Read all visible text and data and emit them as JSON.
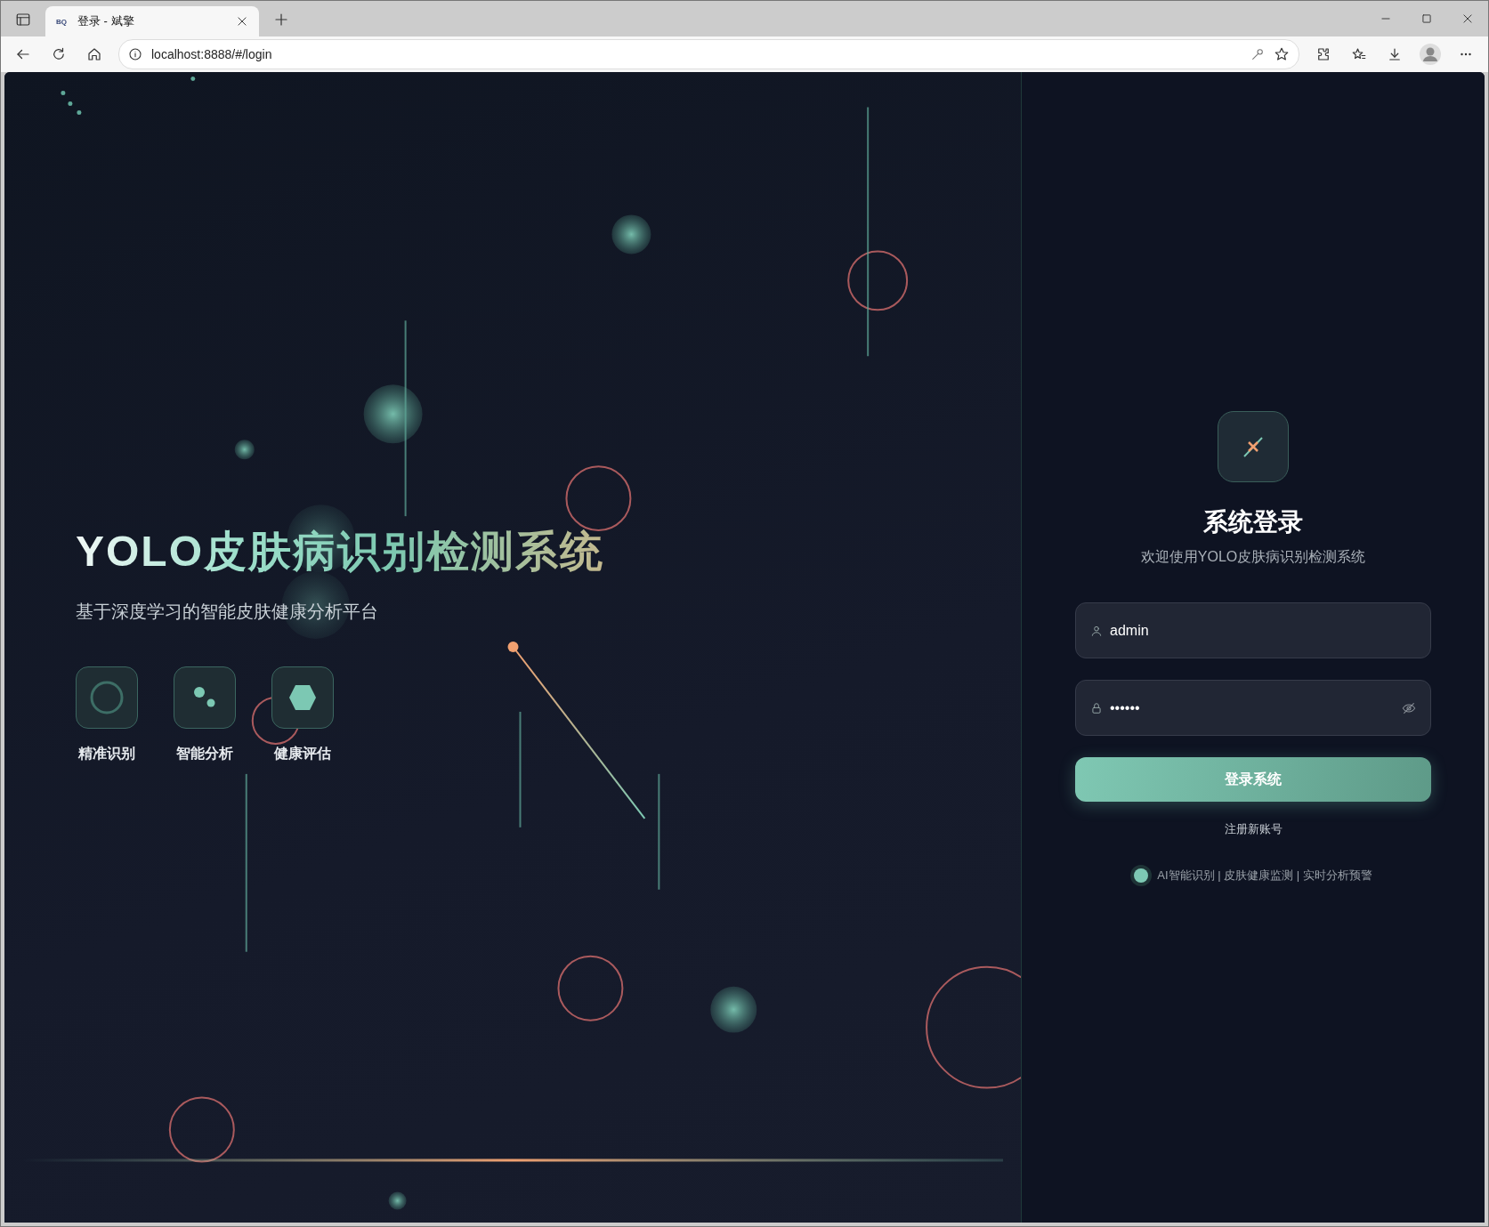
{
  "browser": {
    "tab": {
      "favicon": "BQ",
      "title": "登录 - 斌擎"
    },
    "address": "localhost:8888/#/login"
  },
  "hero": {
    "title": "YOLO皮肤病识别检测系统",
    "subtitle": "基于深度学习的智能皮肤健康分析平台",
    "features": [
      {
        "kind": "ring",
        "label": "精准识别"
      },
      {
        "kind": "dots",
        "label": "智能分析"
      },
      {
        "kind": "hexagon",
        "label": "健康评估"
      }
    ]
  },
  "login": {
    "title": "系统登录",
    "subtitle": "欢迎使用YOLO皮肤病识别检测系统",
    "username": {
      "value": "admin"
    },
    "password": {
      "value": "••••••"
    },
    "submit": "登录系统",
    "register": "注册新账号",
    "footer": "AI智能识别 | 皮肤健康监测 | 实时分析预警"
  }
}
